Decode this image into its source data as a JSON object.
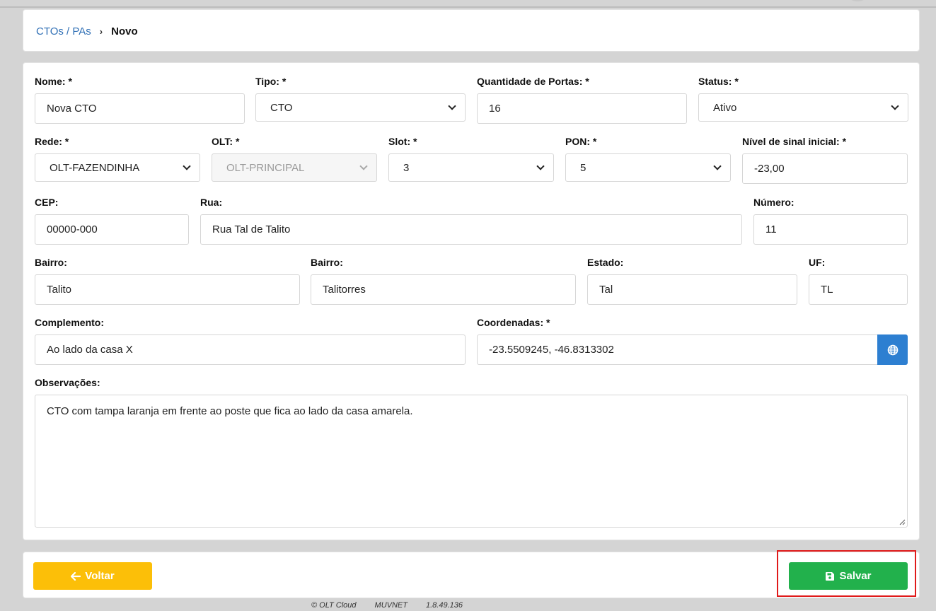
{
  "breadcrumb": {
    "parent": "CTOs / PAs",
    "separator": "›",
    "current": "Novo"
  },
  "form": {
    "nome": {
      "label": "Nome: *",
      "value": "Nova CTO"
    },
    "tipo": {
      "label": "Tipo: *",
      "value": "CTO"
    },
    "portas": {
      "label": "Quantidade de Portas: *",
      "value": "16"
    },
    "status": {
      "label": "Status: *",
      "value": "Ativo"
    },
    "rede": {
      "label": "Rede: *",
      "value": "OLT-FAZENDINHA"
    },
    "olt": {
      "label": "OLT: *",
      "value": "OLT-PRINCIPAL"
    },
    "slot": {
      "label": "Slot: *",
      "value": "3"
    },
    "pon": {
      "label": "PON: *",
      "value": "5"
    },
    "sinal": {
      "label": "Nível de sinal inicial: *",
      "value": "-23,00"
    },
    "cep": {
      "label": "CEP:",
      "value": "00000-000"
    },
    "rua": {
      "label": "Rua:",
      "value": "Rua Tal de Talito"
    },
    "numero": {
      "label": "Número:",
      "value": "11"
    },
    "bairro1": {
      "label": "Bairro:",
      "value": "Talito"
    },
    "bairro2": {
      "label": "Bairro:",
      "value": "Talitorres"
    },
    "estado": {
      "label": "Estado:",
      "value": "Tal"
    },
    "uf": {
      "label": "UF:",
      "value": "TL"
    },
    "complemento": {
      "label": "Complemento:",
      "value": "Ao lado da casa X"
    },
    "coordenadas": {
      "label": "Coordenadas: *",
      "value": "-23.5509245, -46.8313302"
    },
    "observacoes": {
      "label": "Observações:",
      "value": "CTO com tampa laranja em frente ao poste que fica ao lado da casa amarela."
    }
  },
  "actions": {
    "back_label": "Voltar",
    "save_label": "Salvar"
  },
  "footer": {
    "copyright": "© OLT Cloud",
    "company": "MUVNET",
    "version": "1.8.49.136"
  },
  "colors": {
    "link": "#2f6fb5",
    "back": "#fcbf08",
    "save": "#22b14c",
    "globe": "#2d7fd1",
    "highlight": "#e01a1a"
  },
  "icons": {
    "back": "arrow-left-icon",
    "save": "floppy-disk-icon",
    "globe": "globe-icon",
    "select": "chevron-down-icon"
  }
}
